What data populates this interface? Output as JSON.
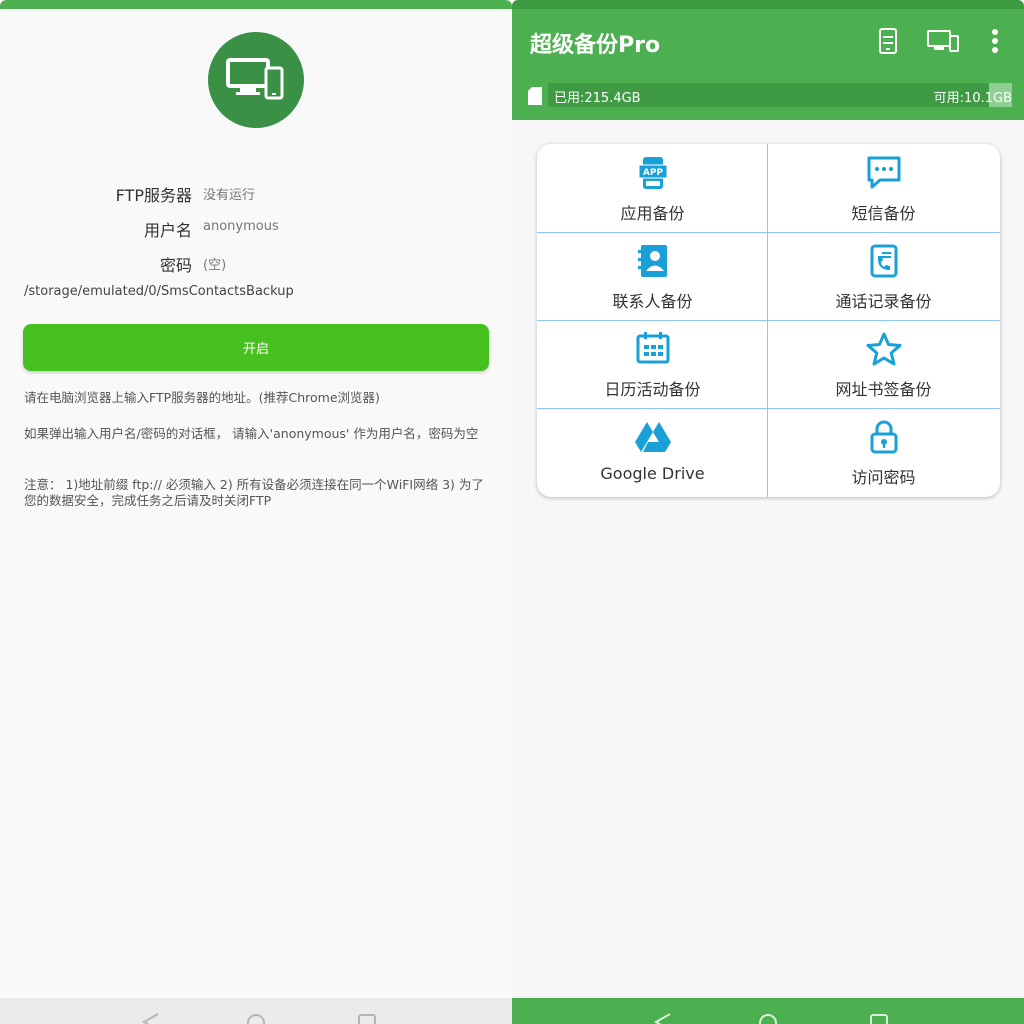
{
  "ftp": {
    "server_label": "FTP服务器",
    "server_value": "没有运行",
    "user_label": "用户名",
    "user_value": "anonymous",
    "password_label": "密码",
    "password_value": "(空)",
    "path": "/storage/emulated/0/SmsContactsBackup",
    "start_button": "开启",
    "hint1": "请在电脑浏览器上输入FTP服务器的地址。(推荐Chrome浏览器)",
    "hint2": "如果弹出输入用户名/密码的对话框， 请输入'anonymous' 作为用户名，密码为空",
    "hint3": "注意： 1)地址前缀 ftp:// 必须输入 2) 所有设备必须连接在同一个WiFI网络 3) 为了您的数据安全，完成任务之后请及时关闭FTP"
  },
  "app": {
    "title": "超级备份Pro",
    "toolbar_icons": [
      "phone-icon",
      "devices-icon",
      "more-vert-icon"
    ],
    "storage": {
      "used": "已用:215.4GB",
      "free": "可用:10.1GB"
    },
    "menu": [
      {
        "label": "应用备份",
        "icon": "app-icon"
      },
      {
        "label": "短信备份",
        "icon": "sms-icon"
      },
      {
        "label": "联系人备份",
        "icon": "contacts-icon"
      },
      {
        "label": "通话记录备份",
        "icon": "call-log-icon"
      },
      {
        "label": "日历活动备份",
        "icon": "calendar-icon"
      },
      {
        "label": "网址书签备份",
        "icon": "star-icon"
      },
      {
        "label": "Google Drive",
        "icon": "google-drive-icon"
      },
      {
        "label": "访问密码",
        "icon": "lock-icon"
      }
    ]
  },
  "colors": {
    "primary": "#4caf50",
    "primary_dark": "#3d9a41",
    "start_button": "#47c11f",
    "icon_blue": "#1aa0d8",
    "divider": "#8cc8ec"
  }
}
